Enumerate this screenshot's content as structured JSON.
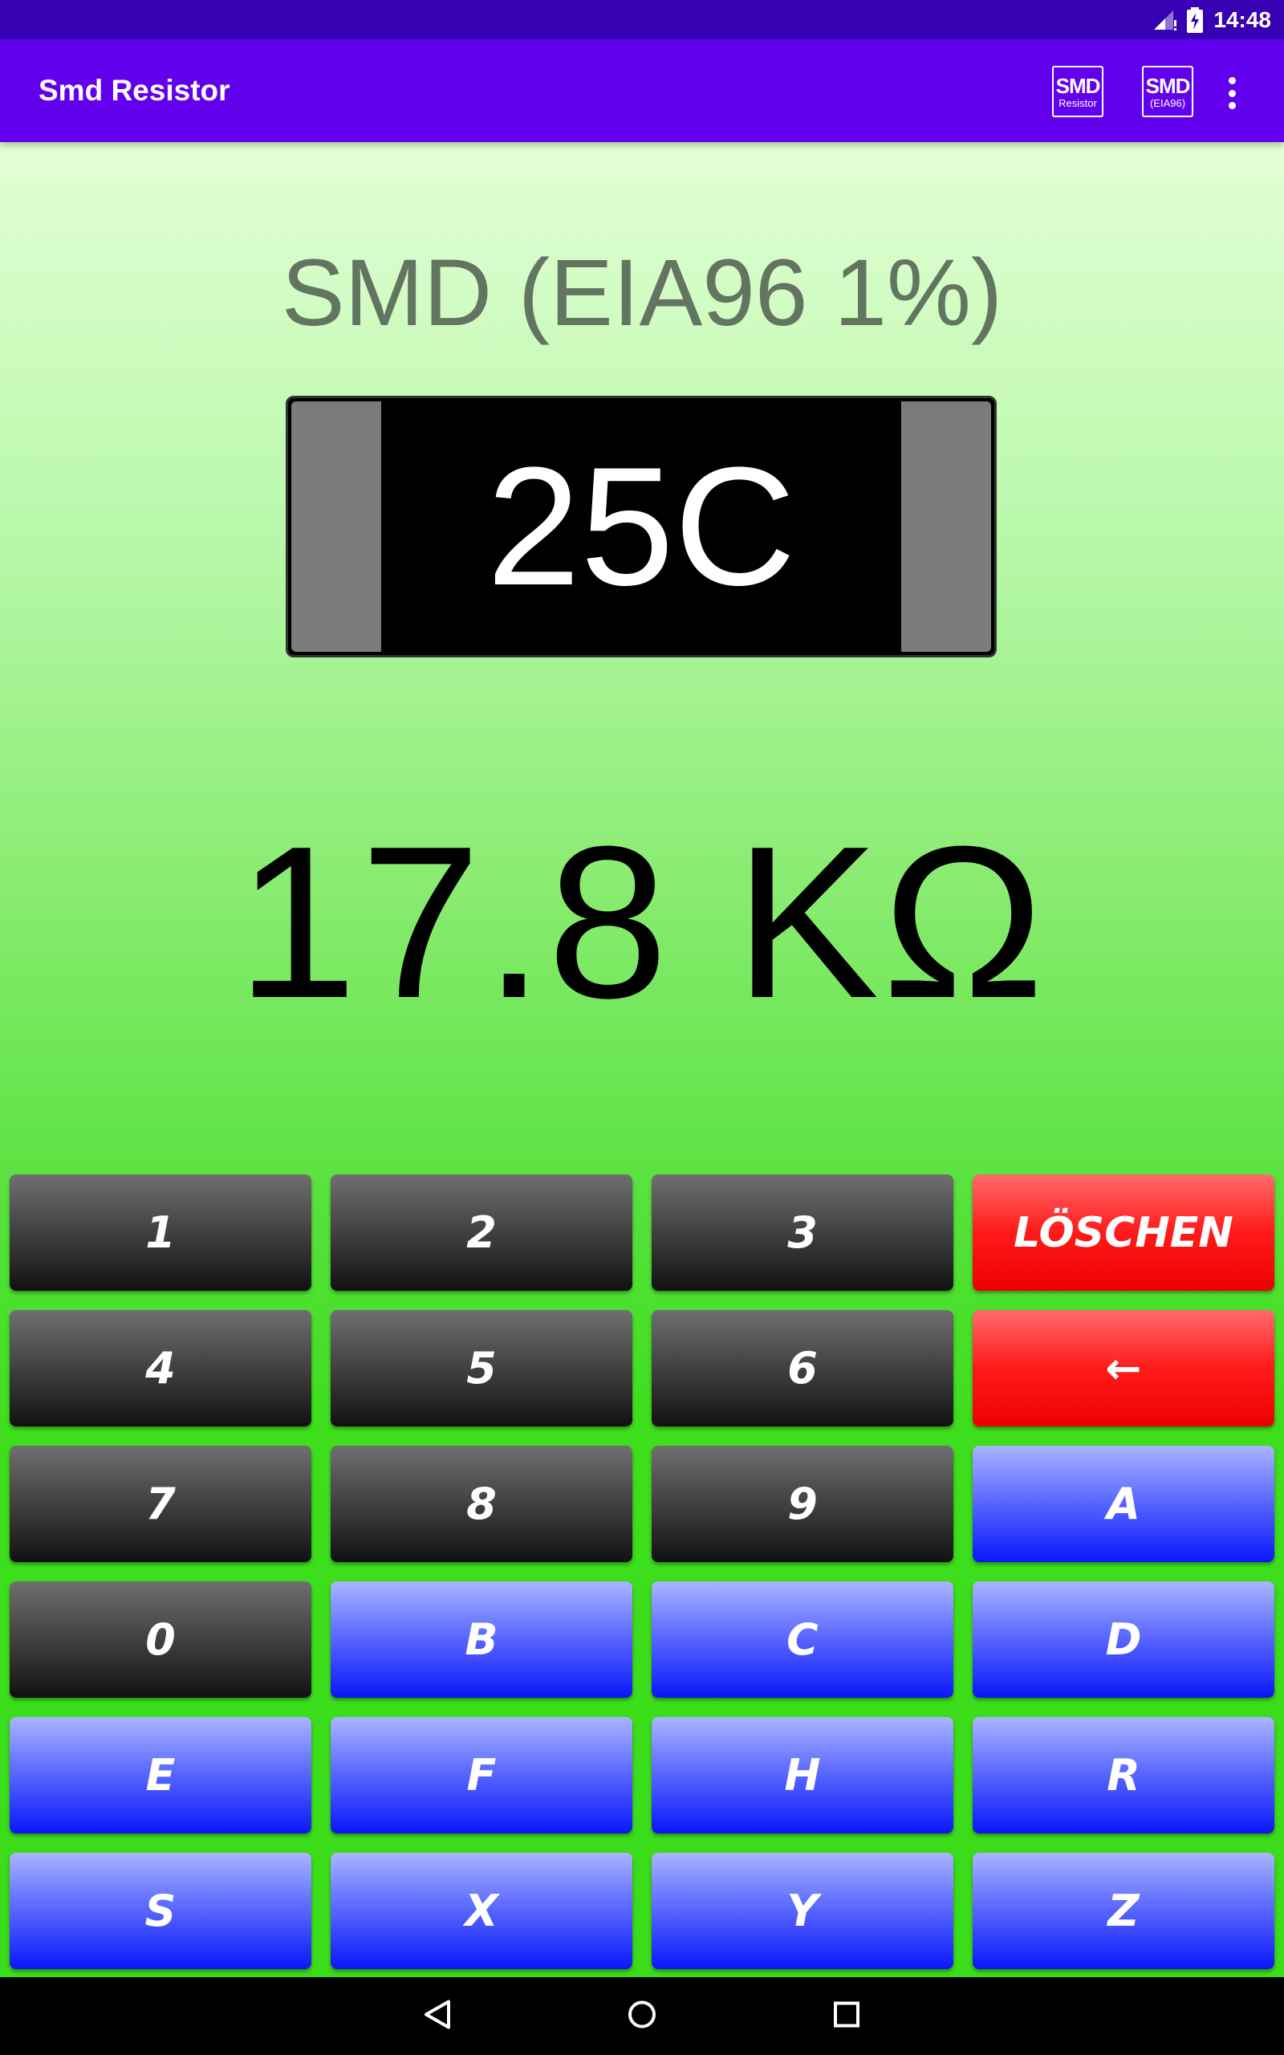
{
  "status_bar": {
    "time": "14:48",
    "icons": [
      "signal-icon",
      "battery-charging-icon"
    ]
  },
  "app_bar": {
    "title": "Smd Resistor",
    "actions": [
      {
        "big": "SMD",
        "small": "Resistor"
      },
      {
        "big": "SMD",
        "small": "(EIA96)"
      }
    ],
    "overflow_icon": "more-vert-icon"
  },
  "main": {
    "mode_title": "SMD (EIA96 1%)",
    "resistor_code": "25C",
    "result": "17.8 KΩ"
  },
  "keypad": {
    "rows": [
      [
        "1",
        "2",
        "3",
        "LÖSCHEN"
      ],
      [
        "4",
        "5",
        "6",
        "←"
      ],
      [
        "7",
        "8",
        "9",
        "A"
      ],
      [
        "0",
        "B",
        "C",
        "D"
      ],
      [
        "E",
        "F",
        "H",
        "R"
      ],
      [
        "S",
        "X",
        "Y",
        "Z"
      ]
    ],
    "colors": {
      "digit": "#3c3c3c",
      "action": "#ff1a1a",
      "letter": "#0a17f8"
    }
  },
  "nav_bar": {
    "icons": [
      "back-icon",
      "home-icon",
      "recents-icon"
    ]
  }
}
